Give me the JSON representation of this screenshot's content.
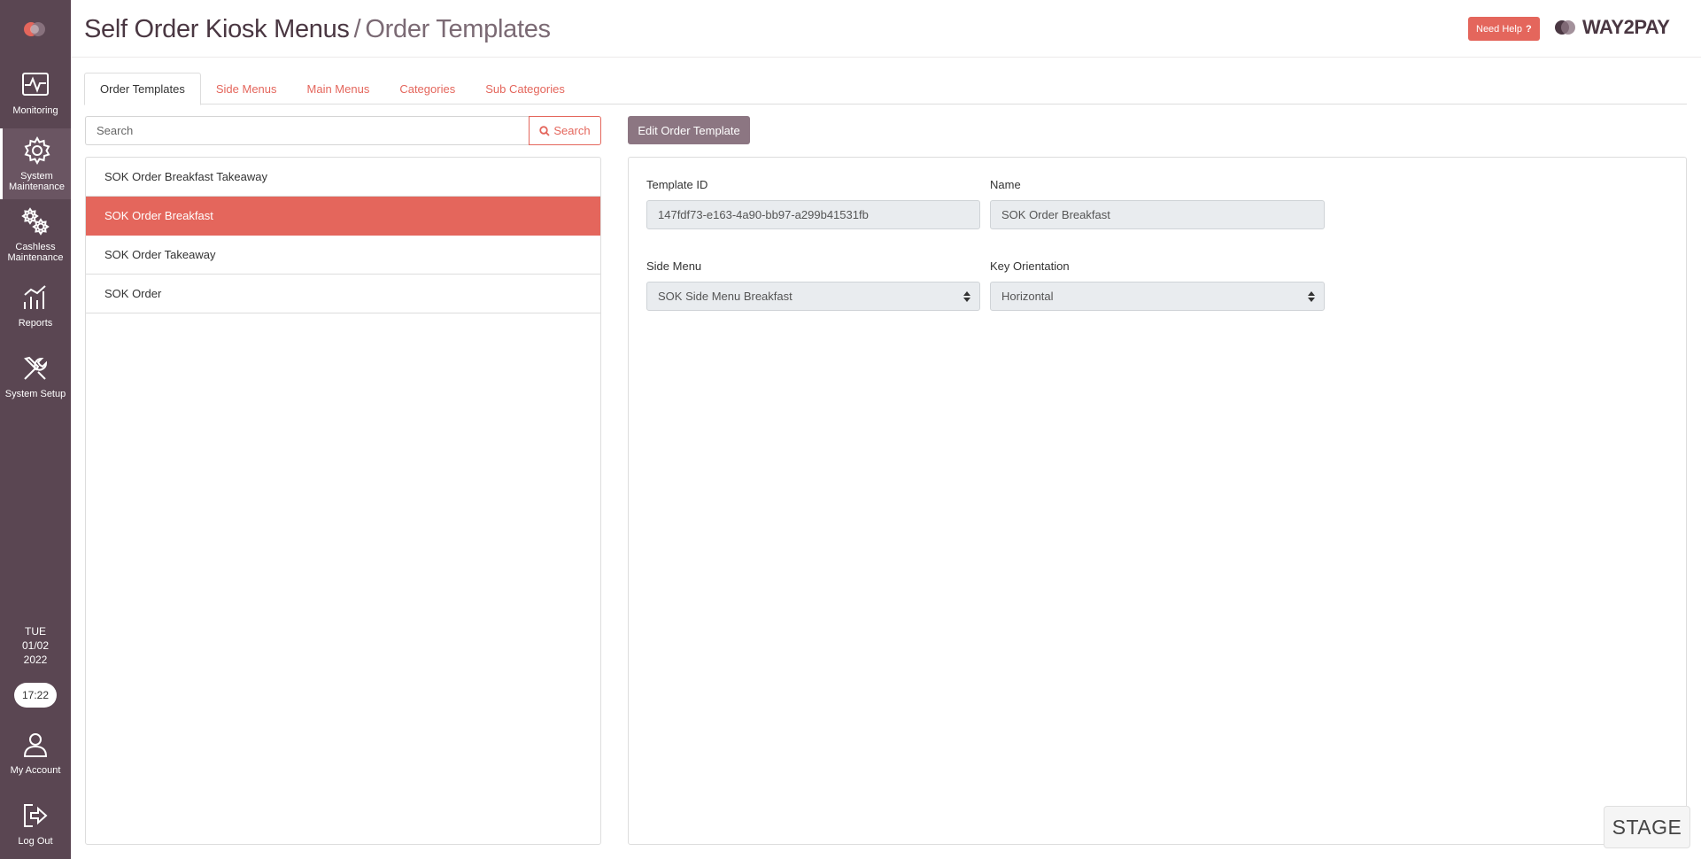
{
  "sidebar": {
    "items": [
      {
        "label": "Monitoring",
        "icon": "monitoring-icon"
      },
      {
        "label": "System Maintenance",
        "icon": "gear-icon"
      },
      {
        "label": "Cashless Maintenance",
        "icon": "gears-icon"
      },
      {
        "label": "Reports",
        "icon": "chart-icon"
      },
      {
        "label": "System Setup",
        "icon": "tools-icon"
      },
      {
        "label": "My Account",
        "icon": "user-icon"
      },
      {
        "label": "Log Out",
        "icon": "logout-icon"
      }
    ],
    "day": "TUE",
    "date": "01/02",
    "year": "2022",
    "time": "17:22"
  },
  "header": {
    "title": "Self Order Kiosk Menus",
    "separator": "/",
    "subtitle": "Order Templates",
    "help_label": "Need Help",
    "help_icon": "?",
    "brand": "WAY2PAY"
  },
  "tabs": [
    {
      "label": "Order Templates",
      "active": true
    },
    {
      "label": "Side Menus"
    },
    {
      "label": "Main Menus"
    },
    {
      "label": "Categories"
    },
    {
      "label": "Sub Categories"
    }
  ],
  "search": {
    "placeholder": "Search",
    "value": "",
    "button_label": "Search"
  },
  "templates": [
    {
      "name": "SOK Order Breakfast Takeaway"
    },
    {
      "name": "SOK Order Breakfast",
      "selected": true
    },
    {
      "name": "SOK Order Takeaway"
    },
    {
      "name": "SOK Order"
    }
  ],
  "edit_panel": {
    "button_label": "Edit Order Template",
    "template_id_label": "Template ID",
    "template_id_value": "147fdf73-e163-4a90-bb97-a299b41531fb",
    "name_label": "Name",
    "name_value": "SOK Order Breakfast",
    "side_menu_label": "Side Menu",
    "side_menu_value": "SOK Side Menu Breakfast",
    "key_orientation_label": "Key Orientation",
    "key_orientation_value": "Horizontal"
  },
  "environment_badge": "STAGE",
  "colors": {
    "sidebar": "#5a4652",
    "accent": "#e4665c",
    "title": "#4a3742",
    "edit_button": "#8c7682"
  }
}
